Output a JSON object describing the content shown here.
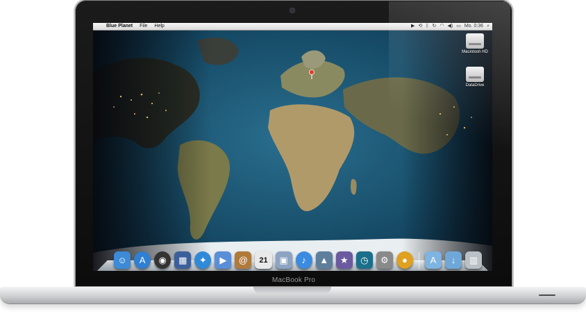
{
  "device": {
    "brand_label": "MacBook Pro"
  },
  "menubar": {
    "app_name": "Blue Planet",
    "menus": [
      "File",
      "Help"
    ],
    "clock": "Mo. 0:36",
    "status_icons": [
      "play-icon",
      "timemachine-icon",
      "bluetooth-icon",
      "sync-icon",
      "wifi-icon",
      "volume-icon",
      "battery-icon",
      "search-icon"
    ]
  },
  "desktop": {
    "icons": [
      {
        "label": "Macintosh HD"
      },
      {
        "label": "DataDrive"
      }
    ]
  },
  "dock": {
    "apps": [
      {
        "icon": "finder-icon",
        "color": "#3d8ad6"
      },
      {
        "icon": "app-store-icon",
        "color": "#2f7fd3"
      },
      {
        "icon": "dashboard-icon",
        "color": "#333333"
      },
      {
        "icon": "mission-control-icon",
        "color": "#3b5f9a"
      },
      {
        "icon": "safari-icon",
        "color": "#2f8ad9"
      },
      {
        "icon": "facetime-icon",
        "color": "#5a8fd8"
      },
      {
        "icon": "address-book-icon",
        "color": "#b07a3c"
      },
      {
        "icon": "calendar-icon",
        "color": "#e9e9e9"
      },
      {
        "icon": "preview-icon",
        "color": "#8da3c2"
      },
      {
        "icon": "itunes-icon",
        "color": "#3b8be0"
      },
      {
        "icon": "iphoto-icon",
        "color": "#5e7f9c"
      },
      {
        "icon": "imovie-icon",
        "color": "#6b5aa0"
      },
      {
        "icon": "time-machine-icon",
        "color": "#1b6f8a"
      },
      {
        "icon": "system-preferences-icon",
        "color": "#8a8a8a"
      },
      {
        "icon": "blue-planet-icon",
        "color": "#e0a020"
      },
      {
        "icon": "applications-folder-icon",
        "color": "#7fb3e0"
      },
      {
        "icon": "downloads-folder-icon",
        "color": "#6fa8d8"
      },
      {
        "icon": "trash-icon",
        "color": "#b9c0c6"
      }
    ],
    "calendar_day": "21"
  }
}
